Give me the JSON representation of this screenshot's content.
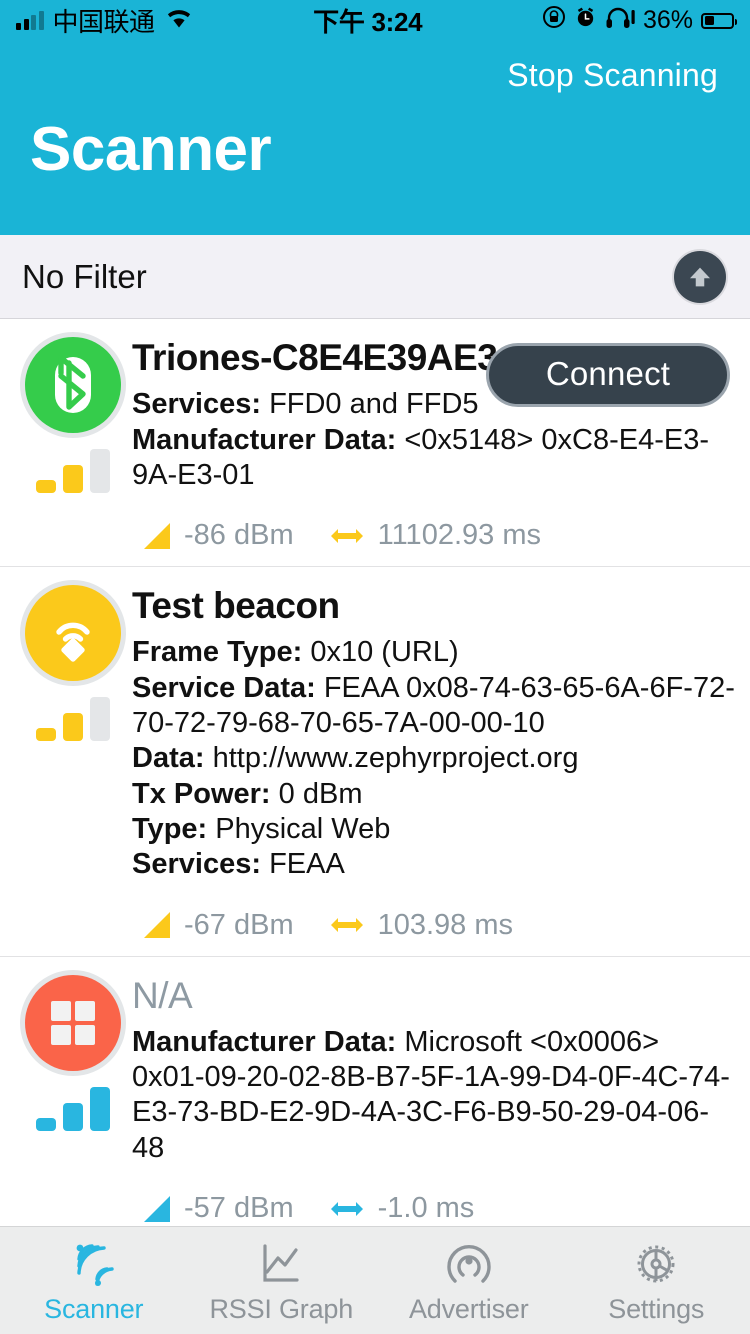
{
  "status_bar": {
    "carrier": "中国联通",
    "signal_icon": "cellular-bars-icon",
    "wifi_icon": "wifi-icon",
    "time": "下午 3:24",
    "rotation_lock_icon": "rotation-lock-icon",
    "alarm_icon": "alarm-clock-icon",
    "headphones_icon": "headphones-icon",
    "battery_percent": "36%",
    "battery_icon": "battery-icon",
    "battery_level": 36
  },
  "nav": {
    "action_label": "Stop Scanning",
    "title": "Scanner",
    "background_color": "#1ab4d6"
  },
  "filter_bar": {
    "label": "No Filter",
    "scroll_top_icon": "arrow-up-icon"
  },
  "devices": [
    {
      "avatar_icon": "bluetooth-icon",
      "avatar_color": "#35cc4b",
      "signal_bars": {
        "filled": 2,
        "total": 3,
        "color": "#fbc91b"
      },
      "name": "Triones-C8E4E39AE3",
      "name_muted": false,
      "action_label": "Connect",
      "details": [
        {
          "label": "Services:",
          "value": "FFD0 and FFD5"
        },
        {
          "label": "Manufacturer Data:",
          "value": " <0x5148> 0xC8-E4-E3-9A-E3-01"
        }
      ],
      "rssi": "-86 dBm",
      "interval": "11102.93 ms",
      "stat_color": "#fbc91b"
    },
    {
      "avatar_icon": "beacon-icon",
      "avatar_color": "#fbc91b",
      "signal_bars": {
        "filled": 2,
        "total": 3,
        "color": "#fbc91b"
      },
      "name": "Test beacon",
      "name_muted": false,
      "action_label": "",
      "details": [
        {
          "label": "Frame Type:",
          "value": "0x10 (URL)"
        },
        {
          "label": "Service Data:",
          "value": "FEAA 0x08-74-63-65-6A-6F-72-70-72-79-68-70-65-7A-00-00-10"
        },
        {
          "label": "Data:",
          "value": "http://www.zephyrproject.org"
        },
        {
          "label": "Tx Power:",
          "value": "0 dBm"
        },
        {
          "label": "Type:",
          "value": "Physical Web"
        },
        {
          "label": "Services:",
          "value": "FEAA"
        }
      ],
      "rssi": "-67 dBm",
      "interval": "103.98 ms",
      "stat_color": "#fbc91b"
    },
    {
      "avatar_icon": "windows-logo-icon",
      "avatar_color": "#fa6449",
      "signal_bars": {
        "filled": 3,
        "total": 3,
        "color": "#29b6e0"
      },
      "name": "N/A",
      "name_muted": true,
      "action_label": "",
      "details": [
        {
          "label": "Manufacturer Data:",
          "value": "Microsoft <0x0006> 0x01-09-20-02-8B-B7-5F-1A-99-D4-0F-4C-74-E3-73-BD-E2-9D-4A-3C-F6-B9-50-29-04-06-48"
        }
      ],
      "rssi": "-57 dBm",
      "interval": "-1.0 ms",
      "stat_color": "#29b6e0"
    }
  ],
  "tabs": [
    {
      "label": "Scanner",
      "icon": "scanner-radar-icon",
      "active": true
    },
    {
      "label": "RSSI Graph",
      "icon": "line-chart-icon",
      "active": false
    },
    {
      "label": "Advertiser",
      "icon": "broadcast-icon",
      "active": false
    },
    {
      "label": "Settings",
      "icon": "gear-icon",
      "active": false
    }
  ],
  "colors": {
    "accent": "#1ab4d6",
    "tab_active": "#29b6e0",
    "connect_button": "#36424c"
  }
}
